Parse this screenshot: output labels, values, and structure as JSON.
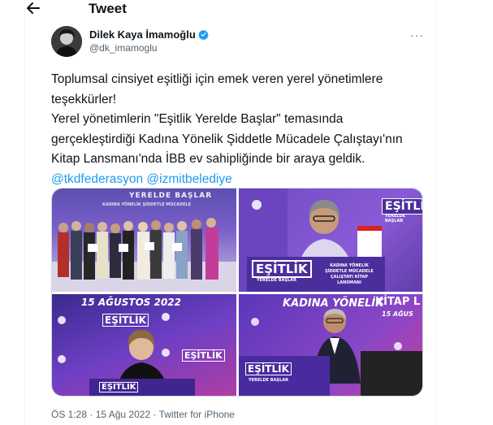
{
  "header": {
    "title": "Tweet"
  },
  "author": {
    "name": "Dilek Kaya İmamoğlu",
    "handle": "@dk_imamoglu"
  },
  "tweet": {
    "line1": "Toplumsal cinsiyet eşitliği için emek veren yerel yönetimlere teşekkürler!",
    "line2": "Yerel yönetimlerin \"Eşitlik Yerelde Başlar\" temasında gerçekleştirdiği Kadına Yönelik Şiddetle Mücadele Çalıştayı'nın Kitap Lansmanı'nda İBB ev sahipliğinde bir araya geldik.",
    "mention1": "@tkdfederasyon",
    "mention2": "@izmitbelediye"
  },
  "photos": {
    "p1_banner": "YERELDE BAŞLAR",
    "p1_sub": "KADINA YÖNELİK ŞİDDETLE MÜCADELE",
    "p2_logo": "EŞİTLİK",
    "p2_logo_sub": "YERELDE BAŞLAR",
    "p2_podium": "EŞİTLİK",
    "p2_podium_sub": "YERELDE BAŞLAR",
    "p2_podium_text": "KADINA YÖNELİK ŞİDDETLE MÜCADELE ÇALIŞTAYI KİTAP LANSMANI",
    "p3_date": "15 AĞUSTOS 2022",
    "p3_logo": "EŞİTLİK",
    "p3_podium": "EŞİTLİK",
    "p4_top": "KADINA YÖNELİK",
    "p4_kitap": "KİTAP L",
    "p4_date": "15 AĞUS",
    "p4_podium": "EŞİTLİK",
    "p4_podium_sub": "YERELDE BAŞLAR"
  },
  "meta": {
    "time": "ÖS 1:28",
    "date": "15 Ağu 2022",
    "source": "Twitter for iPhone",
    "sep": "·"
  },
  "colors": {
    "link": "#1d9bf0",
    "verified": "#1d9bf0",
    "muted": "#536471",
    "text": "#0f1419"
  }
}
